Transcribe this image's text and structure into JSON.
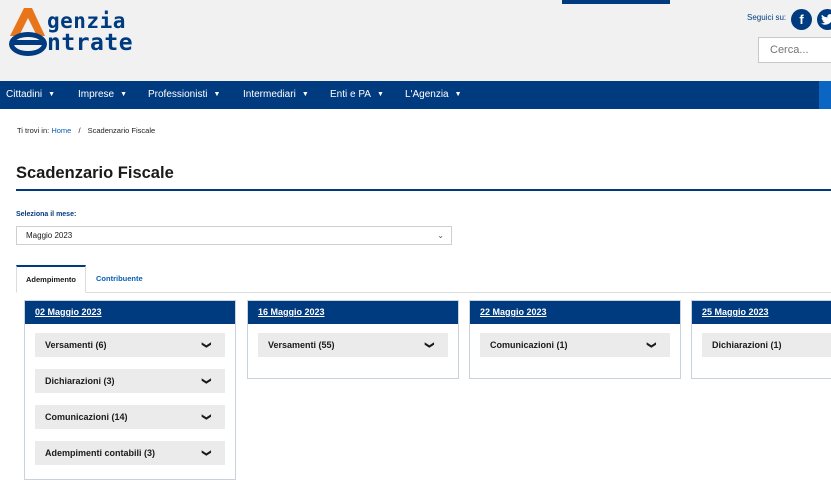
{
  "header": {
    "logo_line1": "genzia",
    "logo_line2": "ntrate",
    "social_label": "Seguici su:",
    "social_icons": [
      "facebook-icon",
      "twitter-icon"
    ],
    "search_placeholder": "Cerca..."
  },
  "nav": {
    "items": [
      {
        "label": "Cittadini"
      },
      {
        "label": "Imprese"
      },
      {
        "label": "Professionisti"
      },
      {
        "label": "Intermediari"
      },
      {
        "label": "Enti e PA"
      },
      {
        "label": "L'Agenzia"
      }
    ]
  },
  "breadcrumb": {
    "prefix": "Ti trovi in:",
    "home": "Home",
    "separator": "/",
    "current": "Scadenzario Fiscale"
  },
  "page": {
    "title": "Scadenzario Fiscale",
    "month_label": "Seleziona il mese:",
    "month_value": "Maggio 2023"
  },
  "tabs": [
    {
      "label": "Adempimento",
      "active": true
    },
    {
      "label": "Contribuente",
      "active": false
    }
  ],
  "cards": [
    {
      "date": "02 Maggio 2023",
      "items": [
        "Versamenti (6)",
        "Dichiarazioni (3)",
        "Comunicazioni (14)",
        "Adempimenti contabili (3)"
      ]
    },
    {
      "date": "16 Maggio 2023",
      "items": [
        "Versamenti (55)"
      ]
    },
    {
      "date": "22 Maggio 2023",
      "items": [
        "Comunicazioni (1)"
      ]
    },
    {
      "date": "25 Maggio 2023",
      "items": [
        "Dichiarazioni (1)"
      ]
    }
  ],
  "colors": {
    "brand_blue": "#003b80",
    "link_blue": "#0a5fb4",
    "logo_orange": "#e8751a",
    "header_bg": "#f1f1f1"
  }
}
